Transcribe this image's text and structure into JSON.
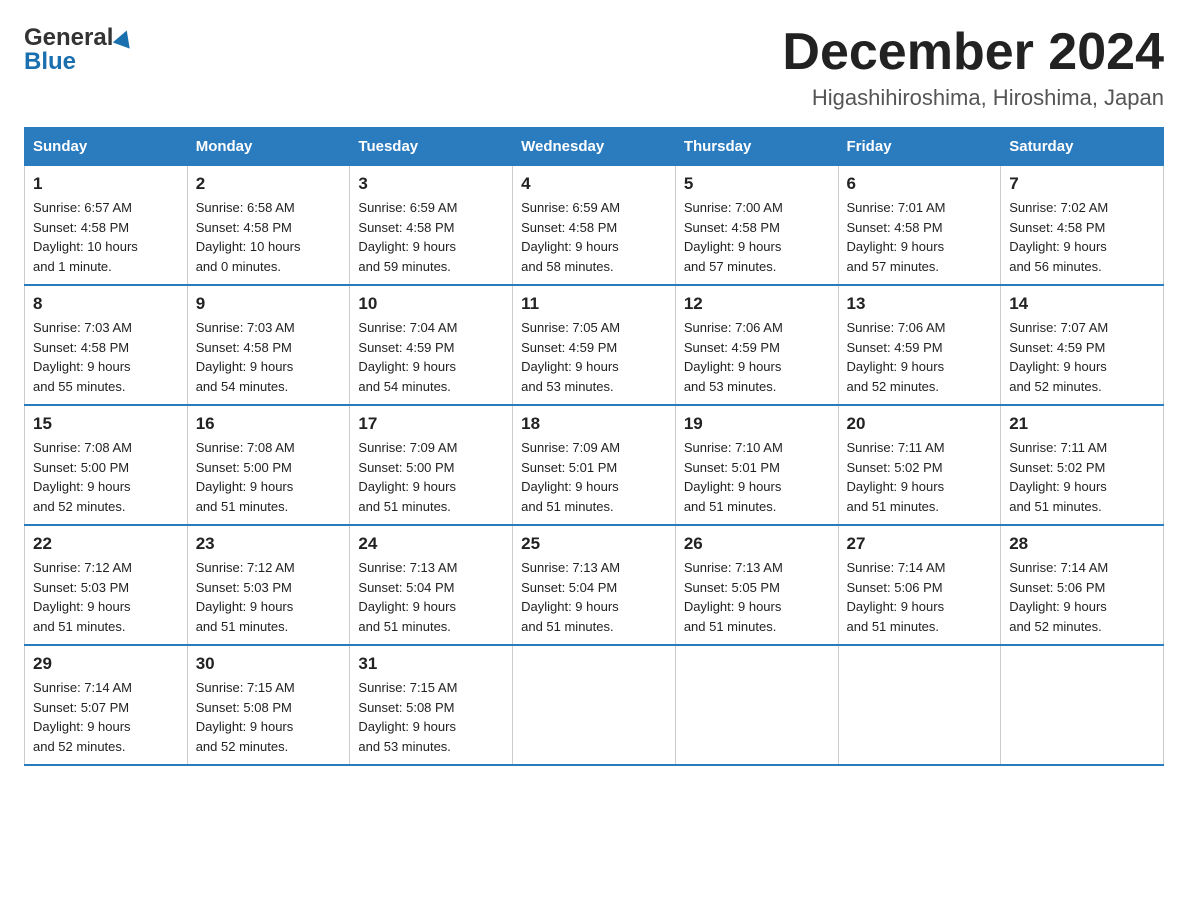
{
  "header": {
    "logo_general": "General",
    "logo_blue": "Blue",
    "month_title": "December 2024",
    "location": "Higashihiroshima, Hiroshima, Japan"
  },
  "weekdays": [
    "Sunday",
    "Monday",
    "Tuesday",
    "Wednesday",
    "Thursday",
    "Friday",
    "Saturday"
  ],
  "weeks": [
    [
      {
        "day": "1",
        "sunrise": "6:57 AM",
        "sunset": "4:58 PM",
        "daylight": "10 hours and 1 minute."
      },
      {
        "day": "2",
        "sunrise": "6:58 AM",
        "sunset": "4:58 PM",
        "daylight": "10 hours and 0 minutes."
      },
      {
        "day": "3",
        "sunrise": "6:59 AM",
        "sunset": "4:58 PM",
        "daylight": "9 hours and 59 minutes."
      },
      {
        "day": "4",
        "sunrise": "6:59 AM",
        "sunset": "4:58 PM",
        "daylight": "9 hours and 58 minutes."
      },
      {
        "day": "5",
        "sunrise": "7:00 AM",
        "sunset": "4:58 PM",
        "daylight": "9 hours and 57 minutes."
      },
      {
        "day": "6",
        "sunrise": "7:01 AM",
        "sunset": "4:58 PM",
        "daylight": "9 hours and 57 minutes."
      },
      {
        "day": "7",
        "sunrise": "7:02 AM",
        "sunset": "4:58 PM",
        "daylight": "9 hours and 56 minutes."
      }
    ],
    [
      {
        "day": "8",
        "sunrise": "7:03 AM",
        "sunset": "4:58 PM",
        "daylight": "9 hours and 55 minutes."
      },
      {
        "day": "9",
        "sunrise": "7:03 AM",
        "sunset": "4:58 PM",
        "daylight": "9 hours and 54 minutes."
      },
      {
        "day": "10",
        "sunrise": "7:04 AM",
        "sunset": "4:59 PM",
        "daylight": "9 hours and 54 minutes."
      },
      {
        "day": "11",
        "sunrise": "7:05 AM",
        "sunset": "4:59 PM",
        "daylight": "9 hours and 53 minutes."
      },
      {
        "day": "12",
        "sunrise": "7:06 AM",
        "sunset": "4:59 PM",
        "daylight": "9 hours and 53 minutes."
      },
      {
        "day": "13",
        "sunrise": "7:06 AM",
        "sunset": "4:59 PM",
        "daylight": "9 hours and 52 minutes."
      },
      {
        "day": "14",
        "sunrise": "7:07 AM",
        "sunset": "4:59 PM",
        "daylight": "9 hours and 52 minutes."
      }
    ],
    [
      {
        "day": "15",
        "sunrise": "7:08 AM",
        "sunset": "5:00 PM",
        "daylight": "9 hours and 52 minutes."
      },
      {
        "day": "16",
        "sunrise": "7:08 AM",
        "sunset": "5:00 PM",
        "daylight": "9 hours and 51 minutes."
      },
      {
        "day": "17",
        "sunrise": "7:09 AM",
        "sunset": "5:00 PM",
        "daylight": "9 hours and 51 minutes."
      },
      {
        "day": "18",
        "sunrise": "7:09 AM",
        "sunset": "5:01 PM",
        "daylight": "9 hours and 51 minutes."
      },
      {
        "day": "19",
        "sunrise": "7:10 AM",
        "sunset": "5:01 PM",
        "daylight": "9 hours and 51 minutes."
      },
      {
        "day": "20",
        "sunrise": "7:11 AM",
        "sunset": "5:02 PM",
        "daylight": "9 hours and 51 minutes."
      },
      {
        "day": "21",
        "sunrise": "7:11 AM",
        "sunset": "5:02 PM",
        "daylight": "9 hours and 51 minutes."
      }
    ],
    [
      {
        "day": "22",
        "sunrise": "7:12 AM",
        "sunset": "5:03 PM",
        "daylight": "9 hours and 51 minutes."
      },
      {
        "day": "23",
        "sunrise": "7:12 AM",
        "sunset": "5:03 PM",
        "daylight": "9 hours and 51 minutes."
      },
      {
        "day": "24",
        "sunrise": "7:13 AM",
        "sunset": "5:04 PM",
        "daylight": "9 hours and 51 minutes."
      },
      {
        "day": "25",
        "sunrise": "7:13 AM",
        "sunset": "5:04 PM",
        "daylight": "9 hours and 51 minutes."
      },
      {
        "day": "26",
        "sunrise": "7:13 AM",
        "sunset": "5:05 PM",
        "daylight": "9 hours and 51 minutes."
      },
      {
        "day": "27",
        "sunrise": "7:14 AM",
        "sunset": "5:06 PM",
        "daylight": "9 hours and 51 minutes."
      },
      {
        "day": "28",
        "sunrise": "7:14 AM",
        "sunset": "5:06 PM",
        "daylight": "9 hours and 52 minutes."
      }
    ],
    [
      {
        "day": "29",
        "sunrise": "7:14 AM",
        "sunset": "5:07 PM",
        "daylight": "9 hours and 52 minutes."
      },
      {
        "day": "30",
        "sunrise": "7:15 AM",
        "sunset": "5:08 PM",
        "daylight": "9 hours and 52 minutes."
      },
      {
        "day": "31",
        "sunrise": "7:15 AM",
        "sunset": "5:08 PM",
        "daylight": "9 hours and 53 minutes."
      },
      null,
      null,
      null,
      null
    ]
  ],
  "labels": {
    "sunrise": "Sunrise:",
    "sunset": "Sunset:",
    "daylight": "Daylight:"
  }
}
